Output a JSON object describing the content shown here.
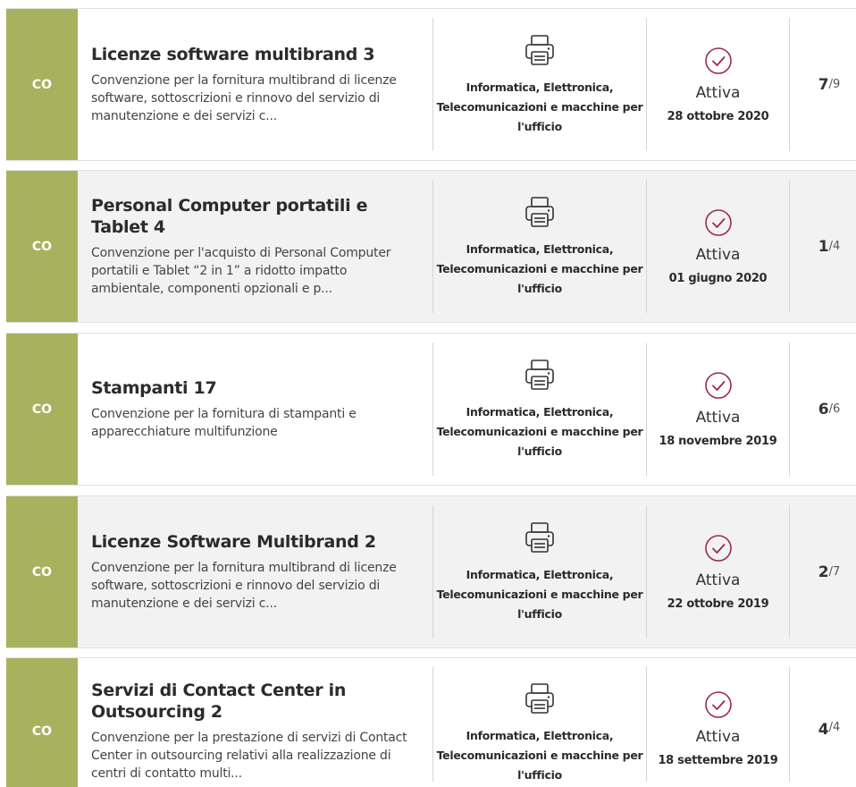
{
  "accent_color": "#a8b15e",
  "status_icon_color": "#9a2a4e",
  "cards": [
    {
      "code": "CO",
      "title": "Licenze software multibrand 3",
      "description": "Convenzione per la fornitura multibrand di licenze software, sottoscrizioni e rinnovo del servizio di manutenzione e dei servizi c...",
      "category_icon": "printer-icon",
      "category": "Informatica, Elettronica, Telecomunicazioni e macchine per l'ufficio",
      "status_icon": "check-circle-icon",
      "status": "Attiva",
      "date": "28 ottobre 2020",
      "count_current": "7",
      "count_total": "9"
    },
    {
      "code": "CO",
      "title": "Personal Computer portatili e Tablet 4",
      "description": "Convenzione per l'acquisto di Personal Computer portatili e Tablet “2 in 1” a ridotto impatto ambientale, componenti opzionali e p...",
      "category_icon": "printer-icon",
      "category": "Informatica, Elettronica, Telecomunicazioni e macchine per l'ufficio",
      "status_icon": "check-circle-icon",
      "status": "Attiva",
      "date": "01 giugno 2020",
      "count_current": "1",
      "count_total": "4"
    },
    {
      "code": "CO",
      "title": "Stampanti 17",
      "description": "Convenzione per la fornitura di stampanti e apparecchiature multifunzione",
      "category_icon": "printer-icon",
      "category": "Informatica, Elettronica, Telecomunicazioni e macchine per l'ufficio",
      "status_icon": "check-circle-icon",
      "status": "Attiva",
      "date": "18 novembre 2019",
      "count_current": "6",
      "count_total": "6"
    },
    {
      "code": "CO",
      "title": "Licenze Software Multibrand 2",
      "description": "Convenzione per la fornitura multibrand di licenze software, sottoscrizioni e rinnovo del servizio di manutenzione e dei servizi c...",
      "category_icon": "printer-icon",
      "category": "Informatica, Elettronica, Telecomunicazioni e macchine per l'ufficio",
      "status_icon": "check-circle-icon",
      "status": "Attiva",
      "date": "22 ottobre 2019",
      "count_current": "2",
      "count_total": "7"
    },
    {
      "code": "CO",
      "title": "Servizi di Contact Center in Outsourcing 2",
      "description": "Convenzione per la prestazione di servizi di Contact Center in outsourcing relativi alla realizzazione di centri di contatto multi...",
      "category_icon": "printer-icon",
      "category": "Informatica, Elettronica, Telecomunicazioni e macchine per l'ufficio",
      "status_icon": "check-circle-icon",
      "status": "Attiva",
      "date": "18 settembre 2019",
      "count_current": "4",
      "count_total": "4"
    }
  ]
}
